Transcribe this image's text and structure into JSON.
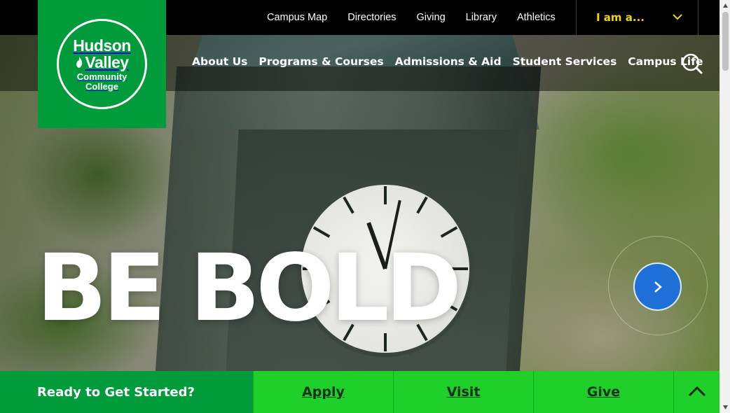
{
  "utility_nav": {
    "links": [
      {
        "label": "Campus Map"
      },
      {
        "label": "Directories"
      },
      {
        "label": "Giving"
      },
      {
        "label": "Library"
      },
      {
        "label": "Athletics"
      }
    ],
    "audience_dropdown": {
      "label": "I am a...",
      "icon": "chevron-down-icon",
      "color": "#f2d600"
    }
  },
  "logo": {
    "line1": "Hudson",
    "line2": "Valley",
    "line3": "Community",
    "line4": "College",
    "bg_color": "#009b3a"
  },
  "main_nav": {
    "items": [
      {
        "label": "About Us"
      },
      {
        "label": "Programs & Courses"
      },
      {
        "label": "Admissions & Aid"
      },
      {
        "label": "Student Services"
      },
      {
        "label": "Campus Life"
      }
    ],
    "search_icon": "search-icon"
  },
  "hero": {
    "headline": "BE BOLD",
    "next_icon": "chevron-right-icon",
    "next_button_color": "#1f6fd8"
  },
  "cta_bar": {
    "label": "Ready to Get Started?",
    "buttons": [
      {
        "label": "Apply"
      },
      {
        "label": "Visit"
      },
      {
        "label": "Give"
      }
    ],
    "back_to_top_icon": "chevron-up-icon",
    "button_color": "#1fcf2a",
    "label_color": "#009b3a"
  }
}
